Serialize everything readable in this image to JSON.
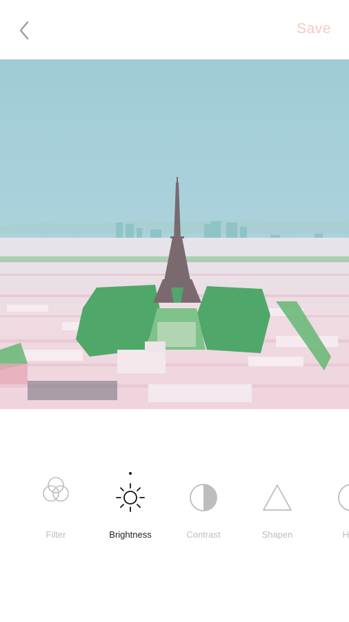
{
  "header": {
    "back_icon": "chevron-left-icon",
    "save_label": "Save",
    "save_color": "#f6c9c7"
  },
  "photo": {
    "subject": "aerial-city-eiffel-tower"
  },
  "tools": [
    {
      "label": "Filter",
      "icon": "filter-circles-icon",
      "active": false
    },
    {
      "label": "Brightness",
      "icon": "sun-icon",
      "active": true
    },
    {
      "label": "Contrast",
      "icon": "contrast-half-circle-icon",
      "active": false
    },
    {
      "label": "Shapen",
      "icon": "triangle-icon",
      "active": false
    },
    {
      "label": "High",
      "icon": "highlight-icon",
      "active": false
    }
  ],
  "colors": {
    "active_label": "#222222",
    "inactive_label": "#bdbdbd",
    "icon_gray": "#bdbdbd",
    "icon_active": "#111111"
  }
}
